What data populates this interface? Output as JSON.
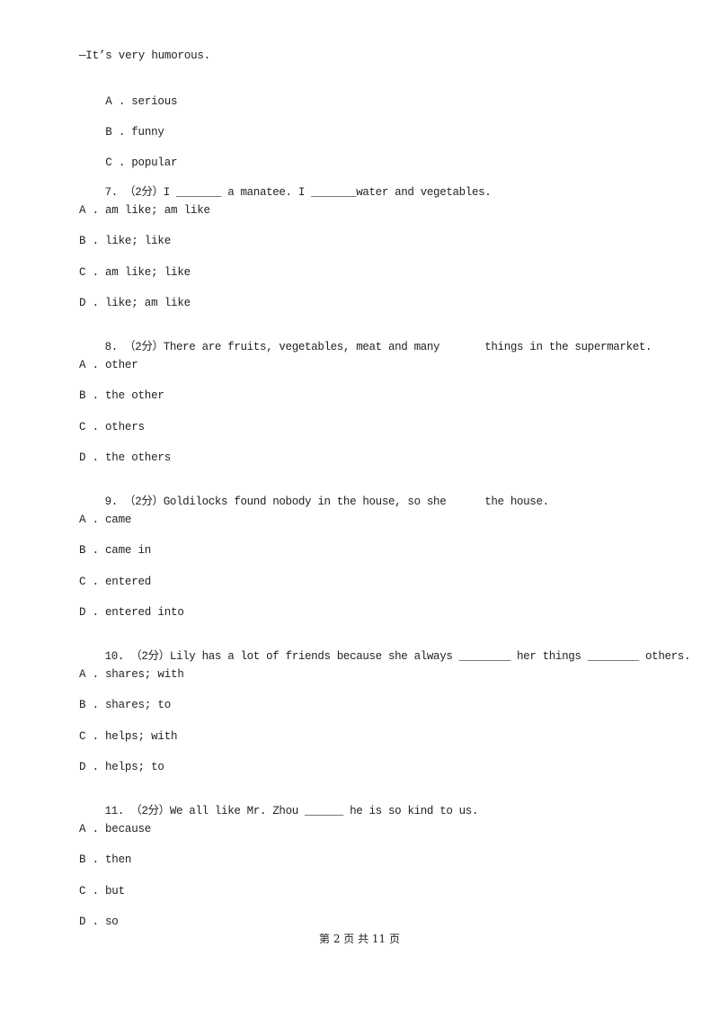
{
  "document": {
    "lead_in": "—It’s very humorous.",
    "lead_in_options": [
      {
        "letter": "A .",
        "text": "serious"
      },
      {
        "letter": "B .",
        "text": "funny"
      },
      {
        "letter": "C .",
        "text": "popular"
      }
    ],
    "questions": [
      {
        "number": "7.",
        "score": "（2分）",
        "stem": "I _______ a manatee. I _______water and vegetables.",
        "options": [
          {
            "letter": "A .",
            "text": "am like; am like"
          },
          {
            "letter": "B .",
            "text": "like; like"
          },
          {
            "letter": "C .",
            "text": "am like; like"
          },
          {
            "letter": "D .",
            "text": "like; am like"
          }
        ]
      },
      {
        "number": "8.",
        "score": "（2分）",
        "stem": "There are fruits, vegetables, meat and many       things in the supermarket.",
        "options": [
          {
            "letter": "A .",
            "text": "other"
          },
          {
            "letter": "B .",
            "text": "the other"
          },
          {
            "letter": "C .",
            "text": "others"
          },
          {
            "letter": "D .",
            "text": "the others"
          }
        ]
      },
      {
        "number": "9.",
        "score": "（2分）",
        "stem": "Goldilocks found nobody in the house, so she      the house.",
        "options": [
          {
            "letter": "A .",
            "text": "came"
          },
          {
            "letter": "B .",
            "text": "came in"
          },
          {
            "letter": "C .",
            "text": "entered"
          },
          {
            "letter": "D .",
            "text": "entered into"
          }
        ]
      },
      {
        "number": "10.",
        "score": "（2分）",
        "stem": "Lily has a lot of friends because she always ________ her things ________ others.",
        "options": [
          {
            "letter": "A .",
            "text": "shares; with"
          },
          {
            "letter": "B .",
            "text": "shares; to"
          },
          {
            "letter": "C .",
            "text": "helps; with"
          },
          {
            "letter": "D .",
            "text": "helps; to"
          }
        ]
      },
      {
        "number": "11.",
        "score": "（2分）",
        "stem": "We all like Mr. Zhou ______ he is so kind to us.",
        "options": [
          {
            "letter": "A .",
            "text": "because"
          },
          {
            "letter": "B .",
            "text": "then"
          },
          {
            "letter": "C .",
            "text": "but"
          },
          {
            "letter": "D .",
            "text": "so"
          }
        ]
      }
    ]
  },
  "footer": {
    "page_label": "第 2 页 共 11 页"
  }
}
